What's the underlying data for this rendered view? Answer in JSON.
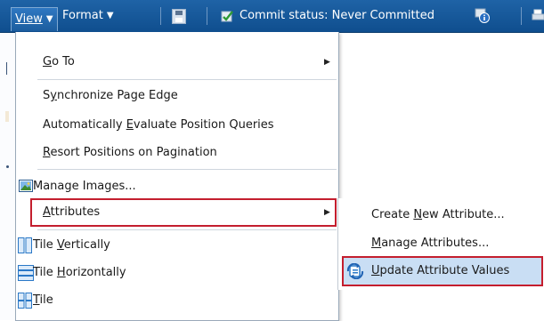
{
  "toolbar": {
    "view_label": "View",
    "format_label": "Format",
    "commit_status": "Commit status: Never Committed"
  },
  "menu": {
    "goto": {
      "pre": "",
      "key": "G",
      "post": "o To"
    },
    "sync": {
      "pre": "S",
      "key": "y",
      "post": "nchronize Page Edge"
    },
    "auto": {
      "pre": "Automatically ",
      "key": "E",
      "post": "valuate Position Queries"
    },
    "resort": {
      "pre": "",
      "key": "R",
      "post": "esort Positions on Pagination"
    },
    "images": {
      "pre": "Manage Images...",
      "key": "",
      "post": ""
    },
    "attributes": {
      "pre": "",
      "key": "A",
      "post": "ttributes"
    },
    "tile_v": {
      "pre": "Tile ",
      "key": "V",
      "post": "ertically"
    },
    "tile_h": {
      "pre": "Tile ",
      "key": "H",
      "post": "orizontally"
    },
    "tile": {
      "pre": "",
      "key": "T",
      "post": "ile"
    }
  },
  "submenu": {
    "create": {
      "pre": "Create ",
      "key": "N",
      "post": "ew Attribute..."
    },
    "manage": {
      "pre": "",
      "key": "M",
      "post": "anage Attributes..."
    },
    "update": {
      "pre": "",
      "key": "U",
      "post": "pdate Attribute Values"
    }
  },
  "colors": {
    "toolbar": "#1f63a6",
    "highlight_border": "#c41e2e",
    "selected_fill": "#c9def4"
  },
  "icons": {
    "save": "save-icon",
    "commit": "commit-check-icon",
    "status": "status-info-icon",
    "print": "print-icon",
    "images": "image-icon",
    "tile_vertical": "tile-vertical-icon",
    "tile_horizontal": "tile-horizontal-icon",
    "tile": "tile-grid-icon",
    "update": "update-attribute-icon"
  }
}
